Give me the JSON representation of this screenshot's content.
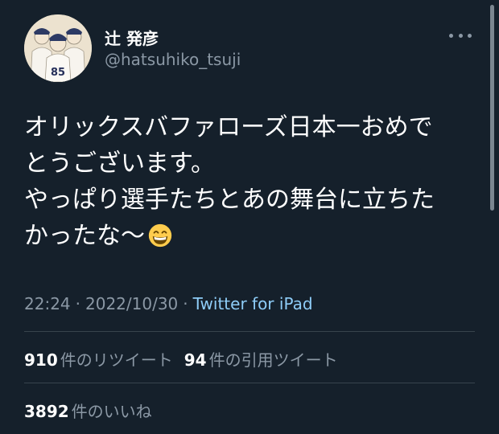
{
  "user": {
    "display_name": "辻 発彦",
    "handle": "@hatsuhiko_tsuji",
    "avatar_jersey_number": "85"
  },
  "tweet": {
    "lines": [
      "オリックスバファローズ日本一おめで",
      "とうございます。",
      "やっぱり選手たちとあの舞台に立ちた",
      "かったな〜"
    ],
    "emoji": "grinning-face-with-smiling-eyes"
  },
  "meta": {
    "time": "22:24",
    "separator": "·",
    "date": "2022/10/30",
    "source": "Twitter for iPad"
  },
  "stats": {
    "retweets": {
      "count": "910",
      "label": "件のリツイート"
    },
    "quotes": {
      "count": "94",
      "label": "件の引用ツイート"
    },
    "likes": {
      "count": "3892",
      "label": "件のいいね"
    }
  },
  "colors": {
    "background": "#15202b",
    "text_primary": "#ffffff",
    "text_secondary": "#8b98a5",
    "link": "#8ecdf8",
    "divider": "#38444d"
  },
  "icons": {
    "more": "more-horizontal-icon",
    "emoji": "grinning-emoji-icon"
  }
}
